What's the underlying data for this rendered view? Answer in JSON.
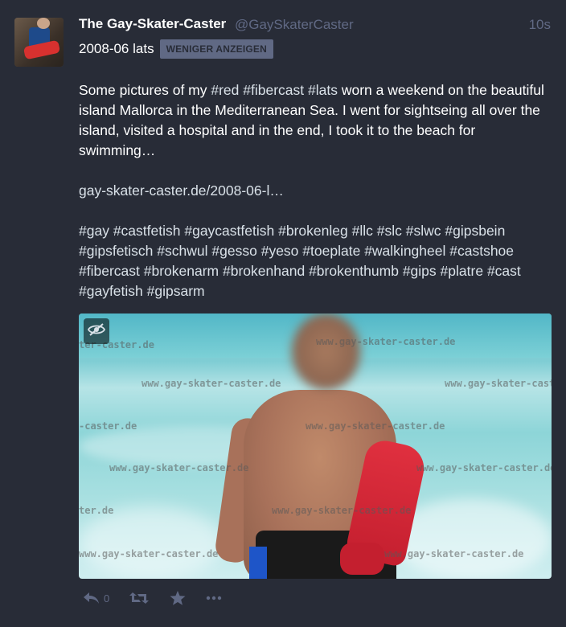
{
  "status": {
    "display_name": "The Gay-Skater-Caster",
    "account": "@GaySkaterCaster",
    "relative_time": "10s",
    "spoiler_text": "2008-06 lats",
    "spoiler_toggle_label": "WENIGER ANZEIGEN",
    "paragraph1": {
      "pre": "Some pictures of my ",
      "tags": [
        "#red",
        "#fibercast",
        "#lats"
      ],
      "post": " worn a weekend on the beautiful island Mallorca in the Mediterranean Sea. I went for sightseing all over the island, visited a hospital and in the end, I took it to the beach for swimming…"
    },
    "link": "gay-skater-caster.de/2008-06-l…",
    "hashtags": [
      "#gay",
      "#castfetish",
      "#gaycastfetish",
      "#brokenleg",
      "#llc",
      "#slc",
      "#slwc",
      "#gipsbein",
      "#gipsfetisch",
      "#schwul",
      "#gesso",
      "#yeso",
      "#toeplate",
      "#walkingheel",
      "#castshoe",
      "#fibercast",
      "#brokenarm",
      "#brokenhand",
      "#brokenthumb",
      "#gips",
      "#platre",
      "#cast",
      "#gayfetish",
      "#gipsarm"
    ],
    "media": {
      "watermark_text": "www.gay-skater-caster.de",
      "watermark_fragments": [
        "ter-caster.de",
        "-caster.de",
        "ter.de"
      ]
    },
    "reply_count": "0"
  },
  "colors": {
    "background": "#282c37",
    "muted": "#606984",
    "text": "#ffffff",
    "hashtag": "#d9e1e8",
    "cast_red": "#d8312f"
  },
  "icons": {
    "hide_media": "eye-slash-icon",
    "reply": "reply-icon",
    "boost": "retweet-icon",
    "favourite": "star-icon",
    "more": "ellipsis-icon"
  }
}
